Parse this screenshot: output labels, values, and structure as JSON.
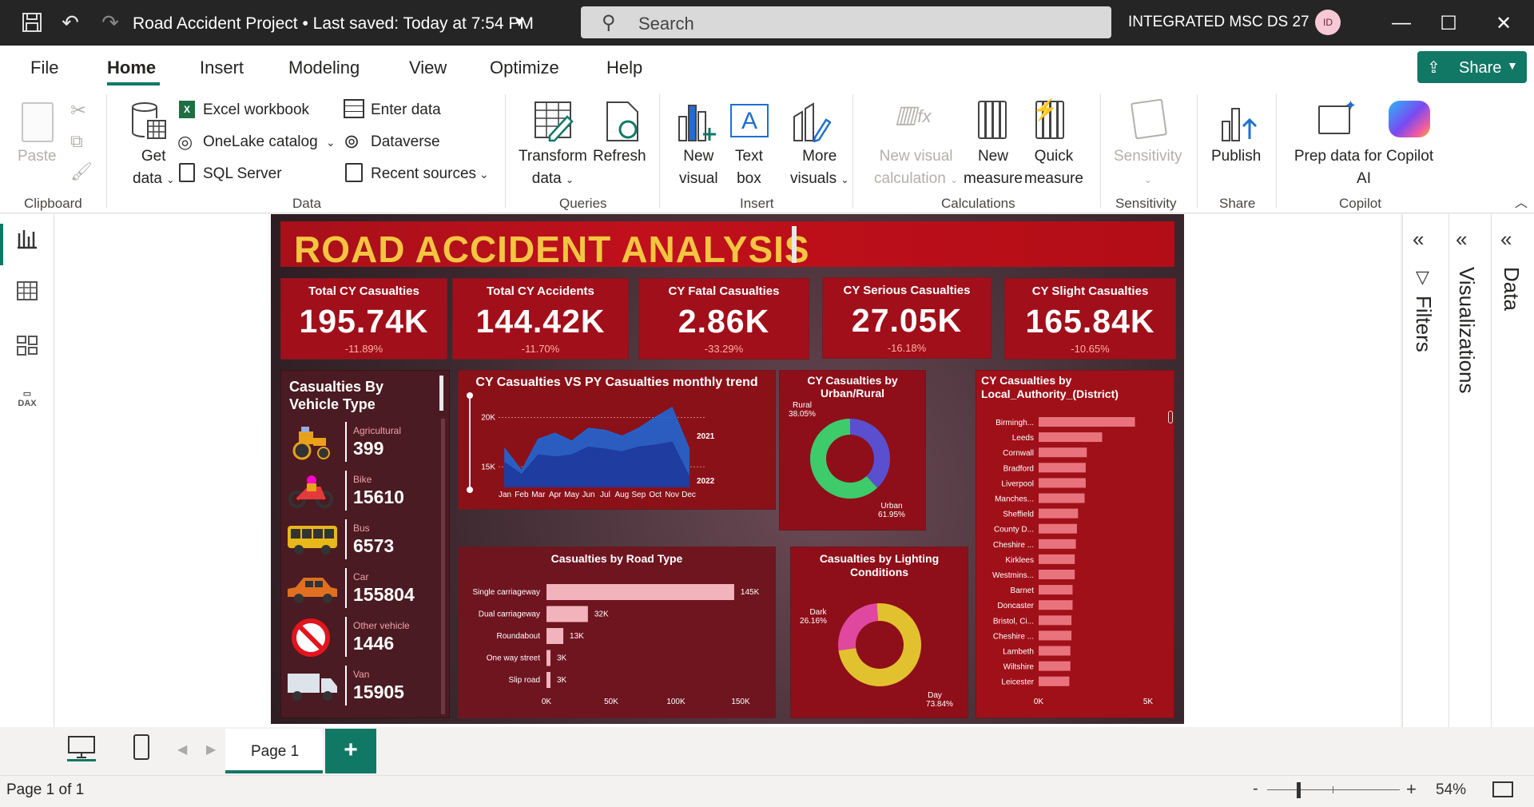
{
  "titlebar": {
    "title": "Road Accident Project • Last saved: Today at 7:54 PM",
    "search_placeholder": "Search",
    "workspace": "INTEGRATED MSC DS 27",
    "avatar_initials": "ID"
  },
  "menu": {
    "file": "File",
    "home": "Home",
    "insert": "Insert",
    "modeling": "Modeling",
    "view": "View",
    "optimize": "Optimize",
    "help": "Help",
    "share": "Share"
  },
  "ribbon": {
    "paste": "Paste",
    "clipboard_group": "Clipboard",
    "get_data_1": "Get",
    "get_data_2": "data",
    "excel": "Excel workbook",
    "onelake": "OneLake catalog",
    "sql": "SQL Server",
    "enter_data": "Enter data",
    "dataverse": "Dataverse",
    "recent": "Recent sources",
    "data_group": "Data",
    "transform_1": "Transform",
    "transform_2": "data",
    "refresh": "Refresh",
    "queries_group": "Queries",
    "new_visual_1": "New",
    "new_visual_2": "visual",
    "text_box_1": "Text",
    "text_box_2": "box",
    "more_visuals_1": "More",
    "more_visuals_2": "visuals",
    "insert_group": "Insert",
    "new_visual_calc_1": "New visual",
    "new_visual_calc_2": "calculation",
    "new_measure_1": "New",
    "new_measure_2": "measure",
    "quick_measure_1": "Quick",
    "quick_measure_2": "measure",
    "calculations_group": "Calculations",
    "sensitivity": "Sensitivity",
    "sensitivity_group": "Sensitivity",
    "publish": "Publish",
    "share_group": "Share",
    "copilot_1": "Prep data for Copilot",
    "copilot_2": "AI",
    "copilot_group": "Copilot"
  },
  "right_panes": {
    "filters": "Filters",
    "visualizations": "Visualizations",
    "data": "Data"
  },
  "pages": {
    "page1": "Page 1",
    "add": "+"
  },
  "status": {
    "page_of": "Page 1 of 1",
    "zoom": "54%",
    "minus": "-",
    "plus": "+"
  },
  "dashboard": {
    "title": "ROAD ACCIDENT ANALYSIS",
    "kpis": [
      {
        "title": "Total CY Casualties",
        "value": "195.74K",
        "delta": "-11.89%"
      },
      {
        "title": "Total CY Accidents",
        "value": "144.42K",
        "delta": "-11.70%"
      },
      {
        "title": "CY Fatal Casualties",
        "value": "2.86K",
        "delta": "-33.29%"
      },
      {
        "title": "CY Serious Casualties",
        "value": "27.05K",
        "delta": "-16.18%"
      },
      {
        "title": "CY Slight Casualties",
        "value": "165.84K",
        "delta": "-10.65%"
      }
    ],
    "vehicle": {
      "title": "Casualties By Vehicle Type",
      "items": [
        {
          "label": "Agricultural",
          "value": "399"
        },
        {
          "label": "Bike",
          "value": "15610"
        },
        {
          "label": "Bus",
          "value": "6573"
        },
        {
          "label": "Car",
          "value": "155804"
        },
        {
          "label": "Other vehicle",
          "value": "1446"
        },
        {
          "label": "Van",
          "value": "15905"
        }
      ]
    },
    "trend_title": "CY Casualties VS PY Casualties monthly trend",
    "urban_title": "CY Casualties by Urban/Rural",
    "district_title_1": "CY Casualties by",
    "district_title_2": "Local_Authority_(District)",
    "road_title": "Casualties by Road Type",
    "light_title_1": "Casualties by Lighting",
    "light_title_2": "Conditions"
  },
  "chart_data": [
    {
      "type": "area",
      "title": "CY Casualties VS PY Casualties monthly trend",
      "categories": [
        "Jan",
        "Feb",
        "Mar",
        "Apr",
        "May",
        "Jun",
        "Jul",
        "Aug",
        "Sep",
        "Oct",
        "Nov",
        "Dec"
      ],
      "series": [
        {
          "name": "2021",
          "values": [
            16800,
            14600,
            17800,
            18400,
            17600,
            18900,
            18700,
            18100,
            18900,
            20000,
            21000,
            16900
          ]
        },
        {
          "name": "2022",
          "values": [
            15400,
            14200,
            16200,
            16000,
            16200,
            17000,
            16800,
            16500,
            17000,
            17200,
            17500,
            14100
          ]
        }
      ],
      "yticks": [
        "20K",
        "15K"
      ],
      "ylim": [
        13000,
        21500
      ],
      "colors": [
        "#1f66d1",
        "#1e3a9c"
      ]
    },
    {
      "type": "pie",
      "title": "CY Casualties by Urban/Rural",
      "labels": [
        "Rural",
        "Urban"
      ],
      "values": [
        38.05,
        61.95
      ],
      "value_labels": [
        "38.05%",
        "61.95%"
      ],
      "colors": [
        "#5a4fcf",
        "#3ecb6b"
      ]
    },
    {
      "type": "bar",
      "title": "CY Casualties by Local_Authority_(District)",
      "categories": [
        "Birmingh...",
        "Leeds",
        "Cornwall",
        "Bradford",
        "Liverpool",
        "Manches...",
        "Sheffield",
        "County D...",
        "Cheshire ...",
        "Kirklees",
        "Westmins...",
        "Barnet",
        "Doncaster",
        "Bristol, Ci...",
        "Cheshire ...",
        "Lambeth",
        "Wiltshire",
        "Leicester"
      ],
      "values": [
        4400,
        2900,
        2200,
        2150,
        2150,
        2100,
        1800,
        1750,
        1700,
        1650,
        1650,
        1550,
        1550,
        1500,
        1500,
        1450,
        1450,
        1400
      ],
      "xticks": [
        "0K",
        "5K"
      ],
      "xlim": [
        0,
        5000
      ],
      "color": "#e8737c"
    },
    {
      "type": "bar",
      "title": "Casualties by Road Type",
      "categories": [
        "Single carriageway",
        "Dual carriageway",
        "Roundabout",
        "One way street",
        "Slip road"
      ],
      "values": [
        145000,
        32000,
        13000,
        3000,
        3000
      ],
      "value_labels": [
        "145K",
        "32K",
        "13K",
        "3K",
        "3K"
      ],
      "xticks": [
        "0K",
        "50K",
        "100K",
        "150K"
      ],
      "xlim": [
        0,
        150000
      ],
      "color": "#f2b3bd"
    },
    {
      "type": "pie",
      "title": "Casualties by Lighting Conditions",
      "labels": [
        "Dark",
        "Day"
      ],
      "values": [
        26.16,
        73.84
      ],
      "value_labels": [
        "26.16%",
        "73.84%"
      ],
      "colors": [
        "#e0479e",
        "#e2c12f"
      ]
    }
  ]
}
